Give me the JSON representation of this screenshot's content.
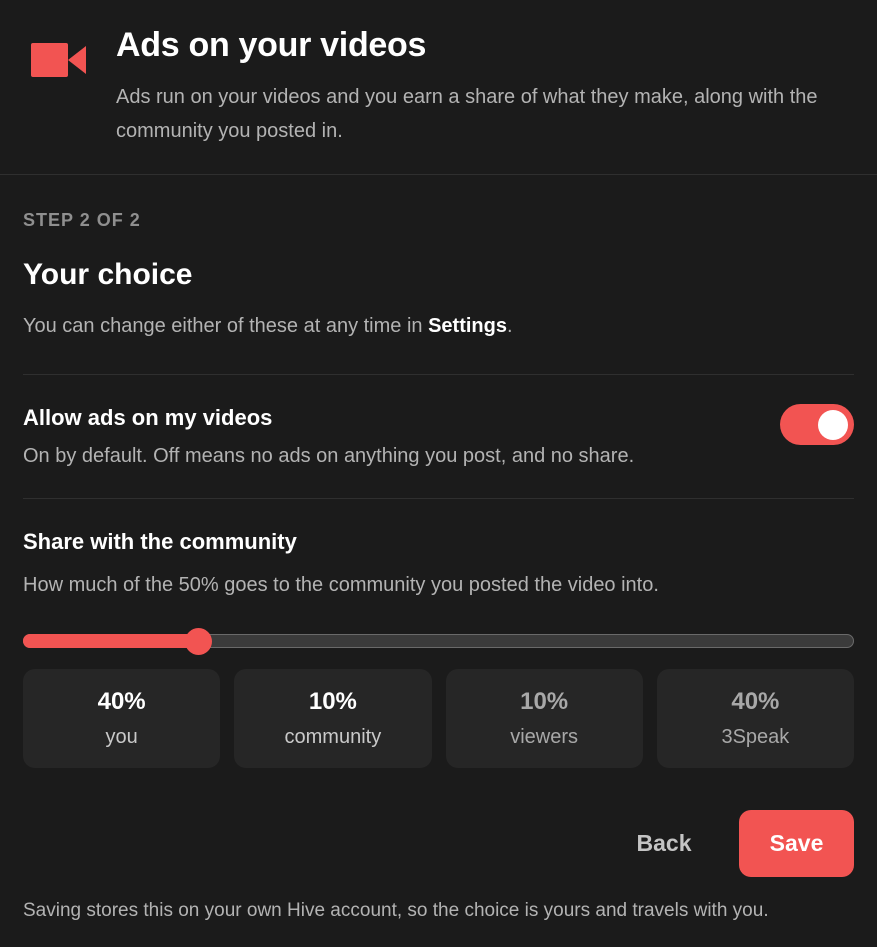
{
  "header": {
    "icon": "video-camera-icon",
    "title": "Ads on your videos",
    "subtitle": "Ads run on your videos and you earn a share of what they make, along with the community you posted in."
  },
  "step": {
    "label": "STEP 2 OF 2",
    "title": "Your choice",
    "desc_prefix": "You can change either of these at any time in ",
    "desc_link": "Settings",
    "desc_suffix": "."
  },
  "ads_toggle": {
    "title": "Allow ads on my videos",
    "description": "On by default. Off means no ads on anything you post, and no share.",
    "enabled": true
  },
  "community_share": {
    "title": "Share with the community",
    "description": "How much of the 50% goes to the community you posted the video into.",
    "slider_fraction": 0.21
  },
  "splits": [
    {
      "percent": "40%",
      "label": "you"
    },
    {
      "percent": "10%",
      "label": "community"
    },
    {
      "percent": "10%",
      "label": "viewers"
    },
    {
      "percent": "40%",
      "label": "3Speak"
    }
  ],
  "actions": {
    "back_label": "Back",
    "save_label": "Save"
  },
  "footer": "Saving stores this on your own Hive account, so the choice is yours and travels with you.",
  "colors": {
    "accent": "#f25452",
    "background": "#1b1b1b",
    "card": "#262626"
  }
}
